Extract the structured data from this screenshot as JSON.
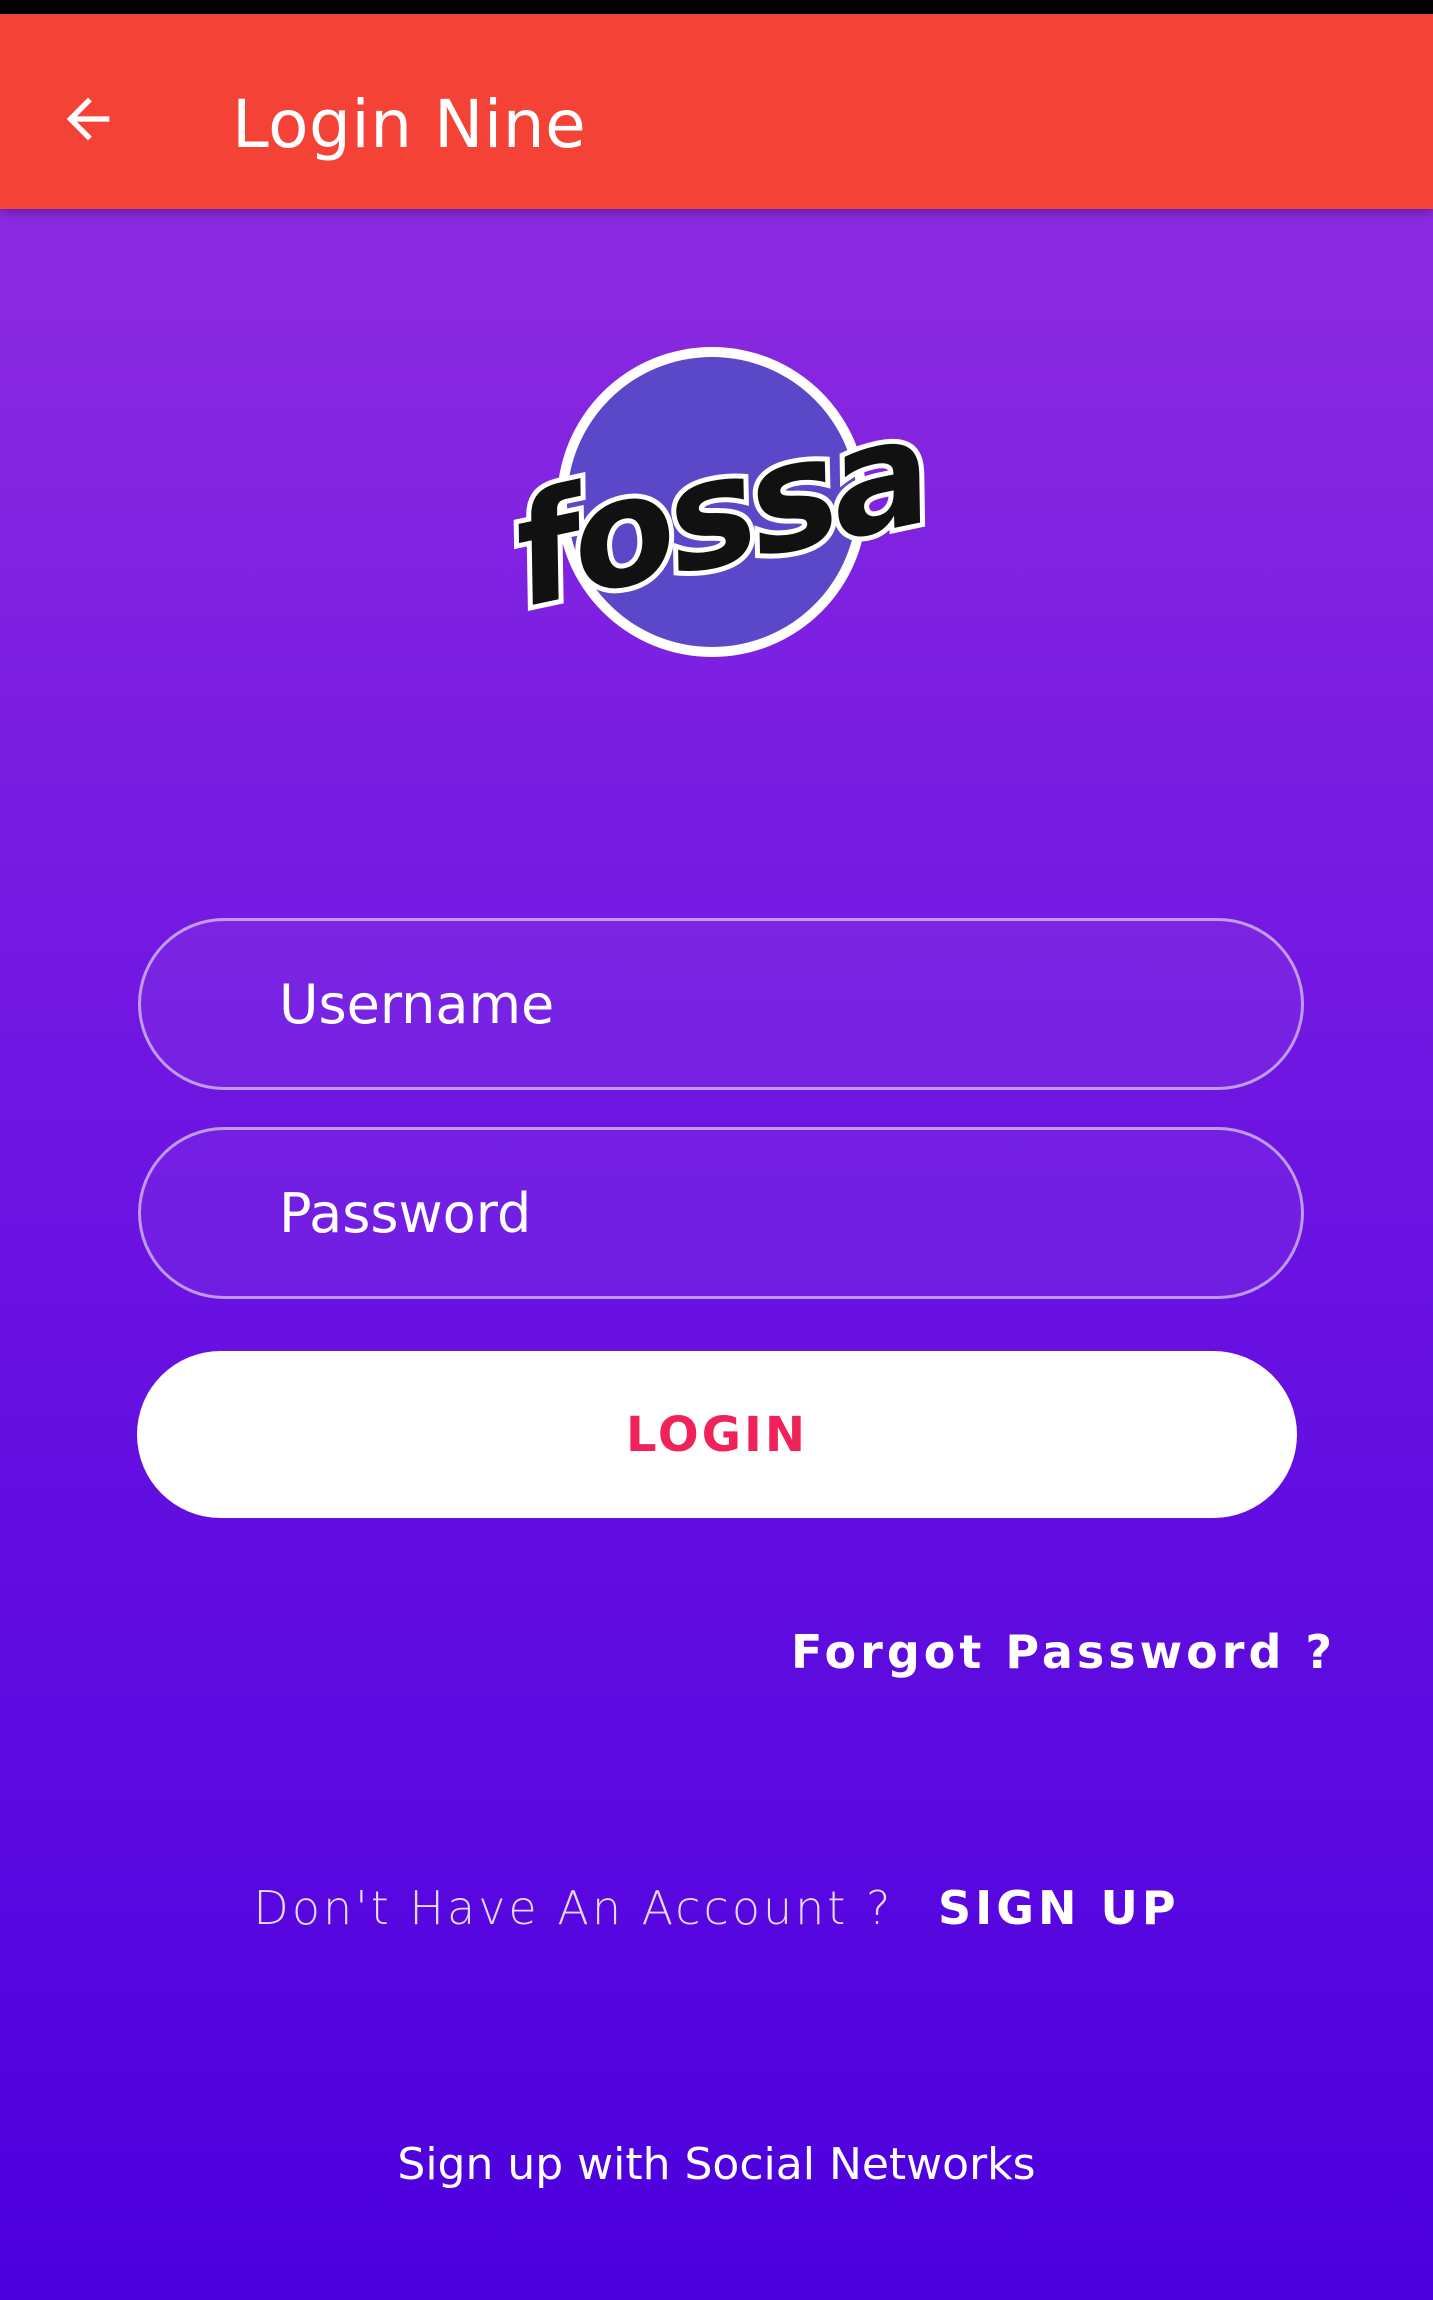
{
  "app_bar": {
    "title": "Login Nine",
    "back_icon": "arrow-left-icon",
    "color": "#f44336"
  },
  "logo": {
    "text": "fossa",
    "circle_color": "#5a48c8"
  },
  "form": {
    "username_placeholder": "Username",
    "password_placeholder": "Password",
    "login_label": "LOGIN",
    "login_text_color": "#f0225a"
  },
  "links": {
    "forgot_password": "Forgot Password ?",
    "no_account": "Don't Have An Account ?",
    "sign_up": "SIGN UP",
    "social": "Sign up with Social Networks"
  },
  "theme": {
    "gradient_top": "#8b2ae0",
    "gradient_bottom": "#4c00de"
  }
}
